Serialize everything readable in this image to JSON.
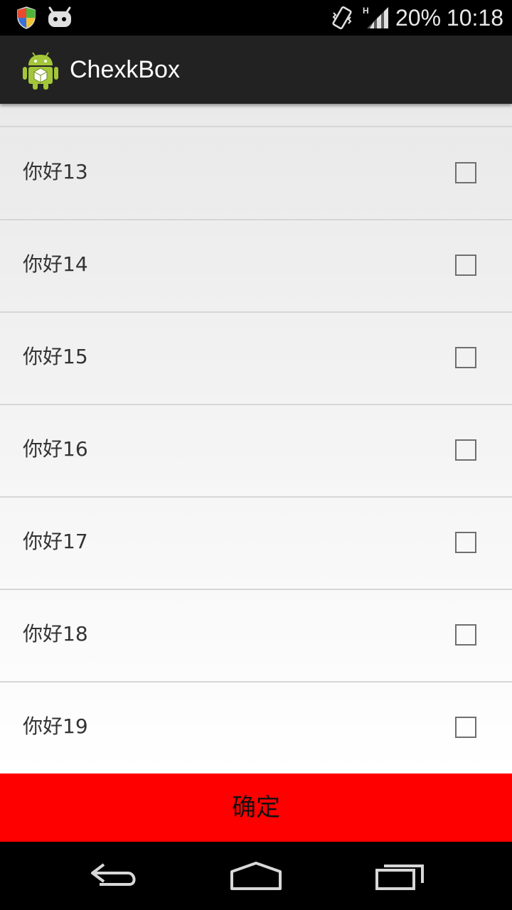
{
  "status_bar": {
    "icons": [
      "shield-icon",
      "cyanogen-mascot-icon",
      "vibrate-icon",
      "hspa-signal-icon"
    ],
    "battery": "20%",
    "time": "10:18"
  },
  "action_bar": {
    "app_icon": "android-icon",
    "title": "ChexkBox"
  },
  "list": {
    "items": [
      {
        "label": "你好13",
        "checked": false
      },
      {
        "label": "你好14",
        "checked": false
      },
      {
        "label": "你好15",
        "checked": false
      },
      {
        "label": "你好16",
        "checked": false
      },
      {
        "label": "你好17",
        "checked": false
      },
      {
        "label": "你好18",
        "checked": false
      },
      {
        "label": "你好19",
        "checked": false
      }
    ]
  },
  "confirm": {
    "label": "确定",
    "color": "#ff0000"
  },
  "nav_bar": {
    "buttons": [
      "back-icon",
      "home-icon",
      "recents-icon"
    ]
  }
}
